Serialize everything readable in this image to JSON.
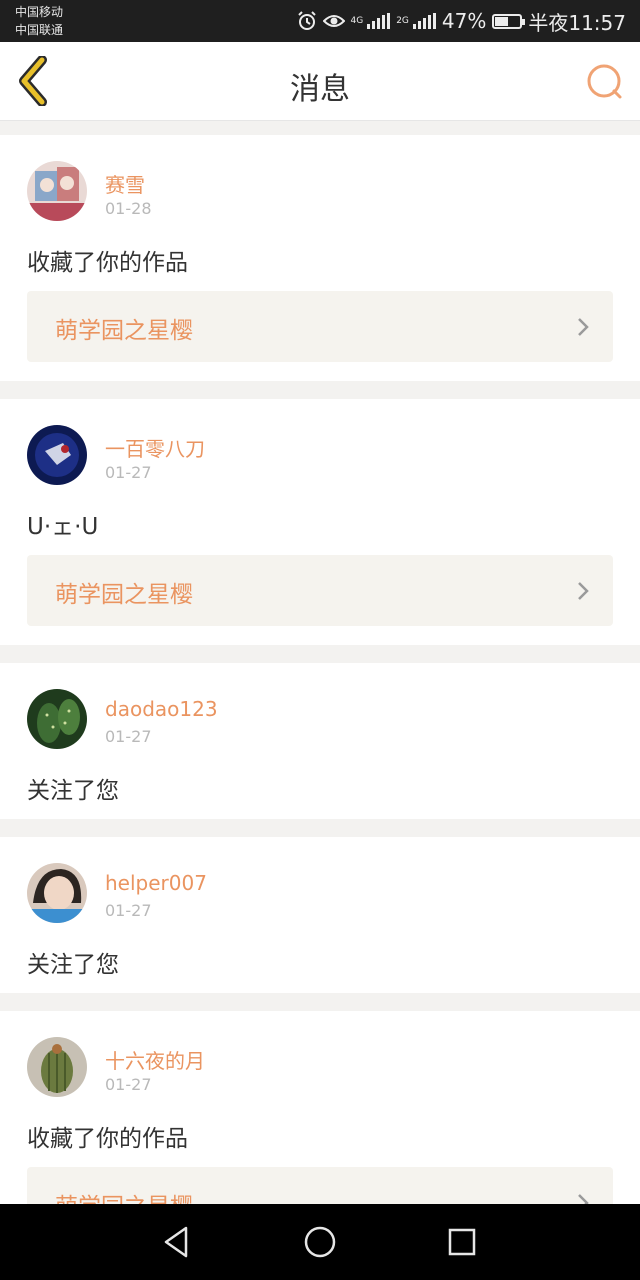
{
  "status_bar": {
    "carrier_1": "中国移动",
    "carrier_2": "中国联通",
    "network_1": "4G",
    "network_2": "2G",
    "battery": "47%",
    "time": "半夜11:57"
  },
  "header": {
    "title": "消息"
  },
  "notifications": [
    {
      "username": "赛雪",
      "date": "01-28",
      "message": "收藏了你的作品",
      "work_title": "萌学园之星樱"
    },
    {
      "username": "一百零八刀",
      "date": "01-27",
      "message": "U·ェ·U",
      "work_title": "萌学园之星樱"
    },
    {
      "username": "daodao123",
      "date": "01-27",
      "message": "关注了您"
    },
    {
      "username": "helper007",
      "date": "01-27",
      "message": "关注了您"
    },
    {
      "username": "十六夜的月",
      "date": "01-27",
      "message": "收藏了你的作品",
      "work_title": "萌学园之星樱"
    }
  ],
  "colors": {
    "accent": "#ea9460",
    "back_arrow": "#b8900d",
    "work_bg": "#f5f3ee",
    "page_bg": "#f3f2f0"
  },
  "icons": {
    "back": "back-chevron-icon",
    "search": "search-icon",
    "nav_back": "triangle-back-icon",
    "nav_home": "circle-home-icon",
    "nav_recent": "square-recent-icon"
  }
}
